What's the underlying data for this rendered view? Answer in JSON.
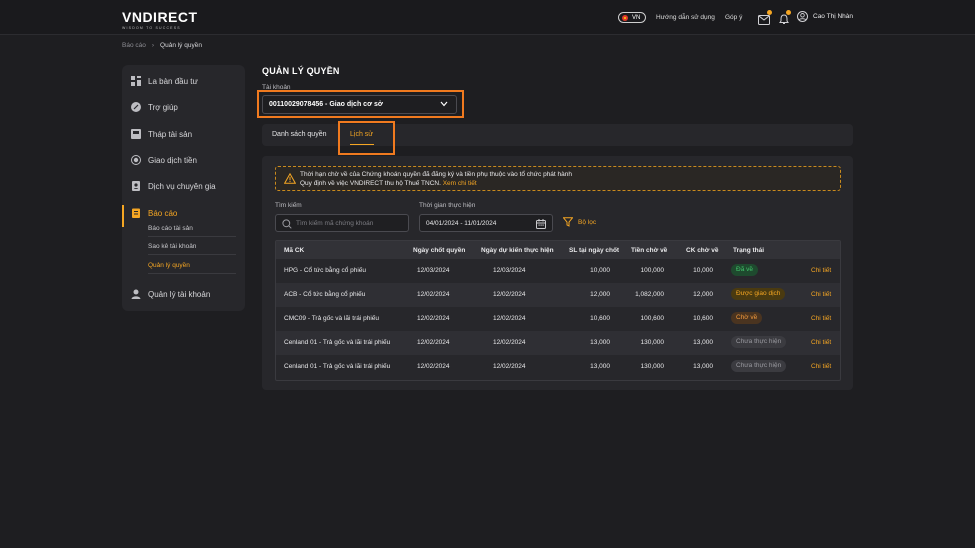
{
  "header": {
    "logo_main": "VNDIRECT",
    "logo_sub": "WISDOM TO SUCCESS",
    "lang": "VN",
    "guide_link": "Hướng dẫn sử dụng",
    "feedback_link": "Góp ý",
    "user_name": "Cao Thị Nhàn"
  },
  "breadcrumb": {
    "parent": "Báo cáo",
    "current": "Quản lý quyền"
  },
  "sidebar": {
    "items": [
      {
        "label": "La bàn đầu tư"
      },
      {
        "label": "Trợ giúp"
      },
      {
        "label": "Tháp tài sản"
      },
      {
        "label": "Giao dịch tiền"
      },
      {
        "label": "Dịch vụ chuyên gia"
      },
      {
        "label": "Báo cáo"
      },
      {
        "label": "Quản lý tài khoản"
      }
    ],
    "subitems": [
      {
        "label": "Báo cáo tài sản"
      },
      {
        "label": "Sao kê tài khoản"
      },
      {
        "label": "Quản lý quyền"
      }
    ]
  },
  "main": {
    "title": "QUẢN LÝ QUYỀN",
    "account_label": "Tài khoản",
    "account_value": "00110029078456 - Giao dịch cơ sở",
    "tabs": [
      {
        "label": "Danh sách quyền"
      },
      {
        "label": "Lịch sử"
      }
    ],
    "notice_line1": "Thời hạn chờ về của Chứng khoán quyền đã đăng ký và tiền phụ thuộc vào tổ chức phát hành",
    "notice_line2": "Quy định về việc VNDIRECT thu hộ Thuế TNCN.",
    "notice_link": "Xem chi tiết",
    "search_label": "Tìm kiếm",
    "search_placeholder": "Tìm kiếm mã chứng khoán",
    "date_label": "Thời gian thực hiện",
    "date_value": "04/01/2024 - 11/01/2024",
    "filter_label": "Bộ lọc"
  },
  "table": {
    "headers": [
      "Mã CK",
      "Ngày chốt quyền",
      "Ngày dự kiến thực hiện",
      "SL tại ngày chốt",
      "Tiền chờ về",
      "CK chờ về",
      "Trạng thái"
    ],
    "detail_label": "Chi tiết",
    "rows": [
      {
        "code": "HPG - Cổ tức bằng cổ phiếu",
        "record_date": "12/03/2024",
        "exec_date": "12/03/2024",
        "qty": "10,000",
        "cash": "100,000",
        "stock": "10,000",
        "status": "Đã về"
      },
      {
        "code": "ACB - Cổ tức bằng cổ phiếu",
        "record_date": "12/02/2024",
        "exec_date": "12/02/2024",
        "qty": "12,000",
        "cash": "1,082,000",
        "stock": "12,000",
        "status": "Được giao dịch"
      },
      {
        "code": "CMC09 - Trả gốc và lãi trái phiếu",
        "record_date": "12/02/2024",
        "exec_date": "12/02/2024",
        "qty": "10,600",
        "cash": "100,600",
        "stock": "10,600",
        "status": "Chờ về"
      },
      {
        "code": "Cenland 01 - Trả gốc và lãi trái phiếu",
        "record_date": "12/02/2024",
        "exec_date": "12/02/2024",
        "qty": "13,000",
        "cash": "130,000",
        "stock": "13,000",
        "status": "Chưa thực hiện"
      },
      {
        "code": "Cenland 01 - Trả gốc và lãi trái phiếu",
        "record_date": "12/02/2024",
        "exec_date": "12/02/2024",
        "qty": "13,000",
        "cash": "130,000",
        "stock": "13,000",
        "status": "Chưa thực hiện"
      }
    ]
  },
  "colors": {
    "accent": "#f5a623",
    "highlight": "#f07a1f",
    "background": "#1e1e21",
    "panel": "#27272b"
  }
}
